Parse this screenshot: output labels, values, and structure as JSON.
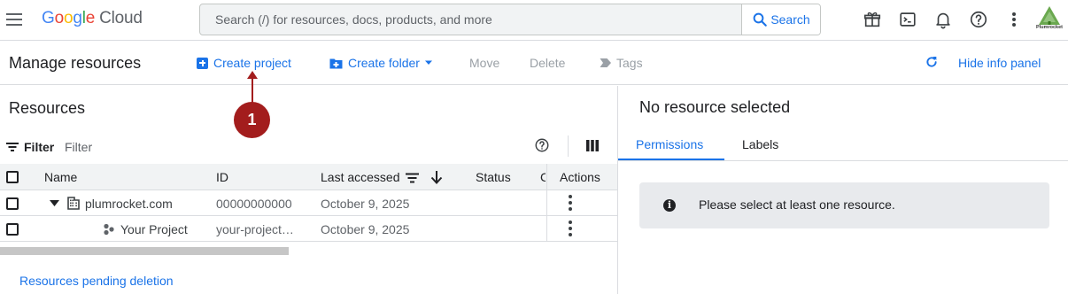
{
  "header": {
    "logo_letters": [
      "G",
      "o",
      "o",
      "g",
      "l",
      "e"
    ],
    "logo_suffix": "Cloud",
    "search_placeholder": "Search (/) for resources, docs, products, and more",
    "search_button": "Search",
    "icons": [
      "menu-icon",
      "gift-icon",
      "cloud-shell-icon",
      "bell-icon",
      "help-icon",
      "more-vert-icon"
    ],
    "avatar_text": "Plumrocket"
  },
  "toolbar": {
    "title": "Manage resources",
    "create_project": "Create project",
    "create_folder": "Create folder",
    "move": "Move",
    "delete": "Delete",
    "tags": "Tags",
    "hide_info": "Hide info panel"
  },
  "resources": {
    "title": "Resources",
    "filter_label": "Filter",
    "filter_placeholder": "Filter",
    "columns": {
      "name": "Name",
      "id": "ID",
      "last_accessed": "Last accessed",
      "status": "Status",
      "c": "C",
      "actions": "Actions"
    },
    "rows": [
      {
        "name": "plumrocket.com",
        "id": "00000000000",
        "last_accessed": "October 9, 2025",
        "type": "organization"
      },
      {
        "name": "Your Project",
        "id": "your-project…",
        "last_accessed": "October 9, 2025",
        "type": "project"
      }
    ],
    "pending_link": "Resources pending deletion"
  },
  "info_panel": {
    "title": "No resource selected",
    "tabs": [
      "Permissions",
      "Labels"
    ],
    "message": "Please select at least one resource."
  },
  "callout": {
    "label": "1"
  },
  "colors": {
    "accent": "#1a73e8",
    "callout": "#a31d1d",
    "disabled": "#9aa0a6"
  }
}
